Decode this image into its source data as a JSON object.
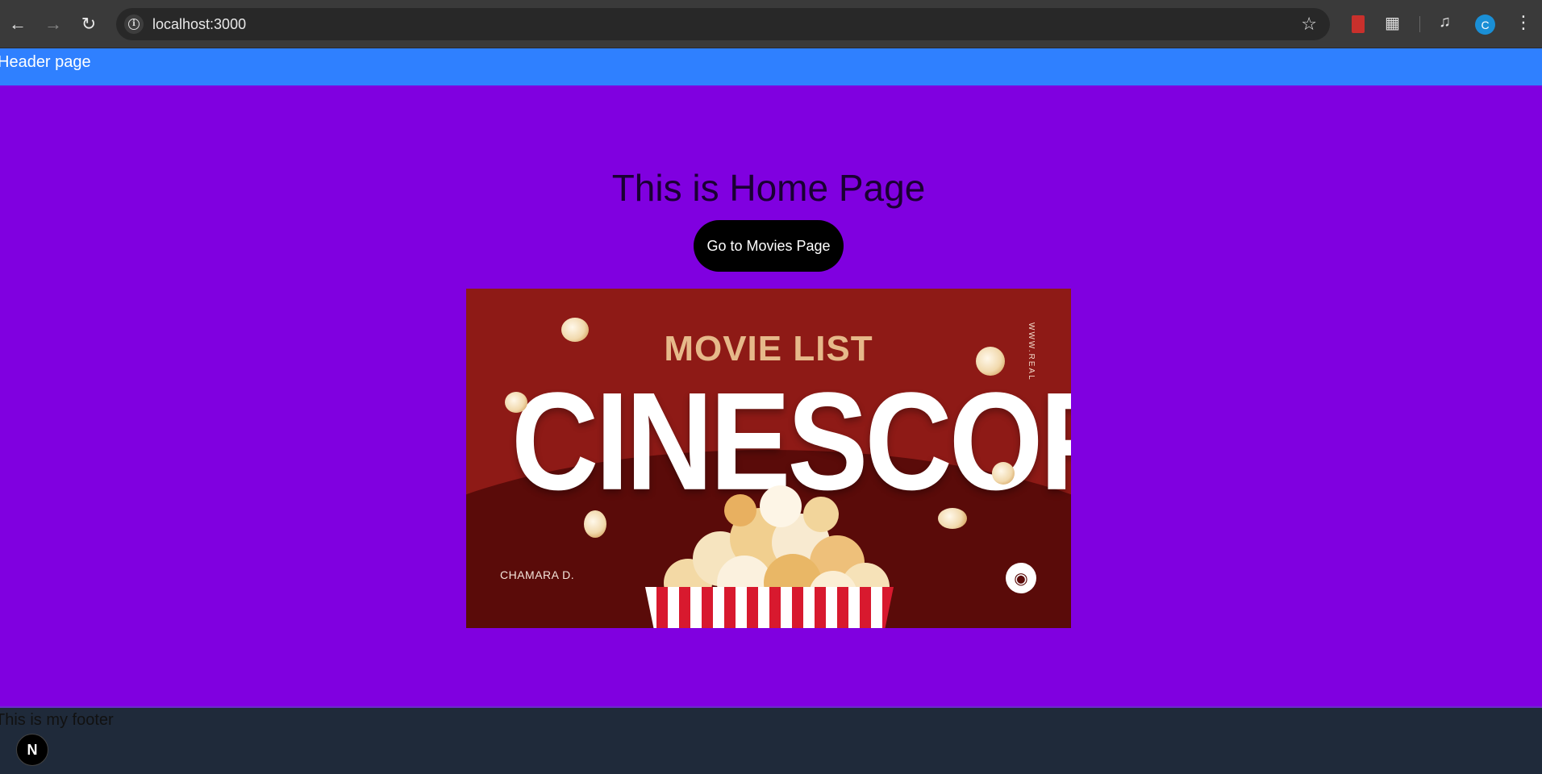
{
  "browser": {
    "url": "localhost:3000",
    "icons": [
      "back-arrow-icon",
      "forward-arrow-icon",
      "reload-icon",
      "site-info-icon",
      "bookmark-star-icon",
      "extension-book-icon",
      "extensions-puzzle-icon",
      "media-controls-icon",
      "profile-avatar-icon",
      "kebab-menu-icon"
    ],
    "profile_initial": "C"
  },
  "header": {
    "label": "Header page",
    "color": "#2f80ff"
  },
  "main": {
    "title": "This is Home Page",
    "button_label": "Go to Movies Page",
    "background": "#8000e0"
  },
  "banner": {
    "kicker": "MOVIE LIST",
    "title": "CINESCOPE",
    "side_text": "WWW.REAL",
    "author": "CHAMARA D.",
    "camera_icon": "movie-camera-icon"
  },
  "footer": {
    "text": "This is my footer",
    "badge": "N"
  }
}
